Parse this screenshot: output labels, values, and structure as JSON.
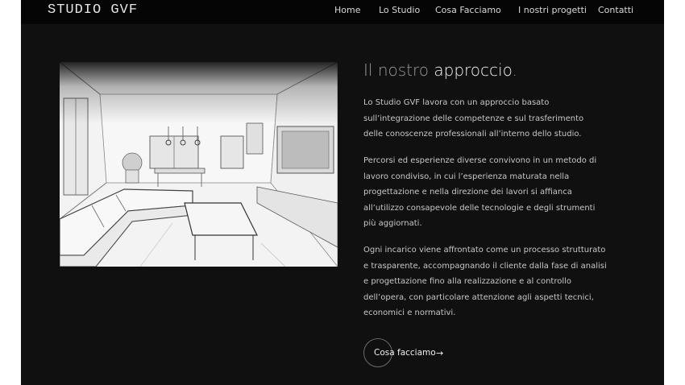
{
  "header": {
    "logo": "STUDIO GVF",
    "nav": [
      "Home",
      "Lo Studio",
      "Cosa Facciamo",
      "I nostri progetti",
      "Contatti"
    ]
  },
  "section": {
    "title_light": "Il nostro ",
    "title_strong": "approccio",
    "title_end": ".",
    "paragraphs": [
      "Lo Studio GVF lavora con un approccio basato sull’integrazione delle competenze e sul trasferimento delle conoscenze professionali all’interno dello studio.",
      "Percorsi ed esperienze diverse convivono in un metodo di lavoro condiviso, in cui l’esperienza maturata nella progettazione e nella direzione dei lavori si affianca all’utilizzo consapevole delle tecnologie e degli strumenti più aggiornati.",
      "Ogni incarico viene affrontato come un processo strutturato e trasparente, accompagnando il cliente dalla fase di analisi e progettazione fino alla realizzazione e al controllo dell’opera, con particolare attenzione agli aspetti tecnici, economici e normativi."
    ],
    "cta_label": "Cosa facciamo",
    "cta_arrow": "→"
  },
  "colors": {
    "page_bg": "#101010",
    "header_bg": "#050505",
    "text": "#c7c7c7",
    "title_dim": "#9a9a9a"
  }
}
